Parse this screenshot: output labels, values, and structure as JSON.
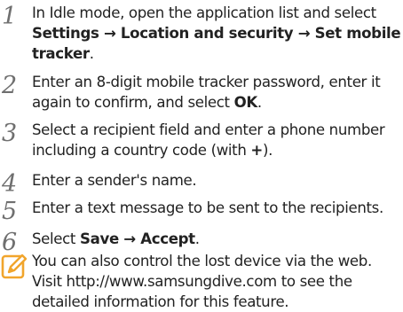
{
  "steps": [
    {
      "number": "1",
      "text_a": "In Idle mode, open the application list and select",
      "path": "Settings → Location and security → Set mobile tracker",
      "text_b": "."
    },
    {
      "number": "2",
      "text_a": "Enter an 8-digit mobile tracker password, enter it again to confirm, and select ",
      "button": "OK",
      "text_b": "."
    },
    {
      "number": "3",
      "text_a": "Select a recipient field and enter a phone number including a country code (with ",
      "symbol": "+",
      "text_b": ")."
    },
    {
      "number": "4",
      "text": "Enter a sender's name."
    },
    {
      "number": "5",
      "text": "Enter a text message to be sent to the recipients."
    },
    {
      "number": "6",
      "text_a": "Select ",
      "path": "Save → Accept",
      "text_b": "."
    }
  ],
  "note": {
    "icon": "note-pencil-icon",
    "text": "You can also control the lost device via the web. Visit http://www.samsungdive.com to see the detailed information for this feature.",
    "icon_color": "#f1a52c"
  }
}
